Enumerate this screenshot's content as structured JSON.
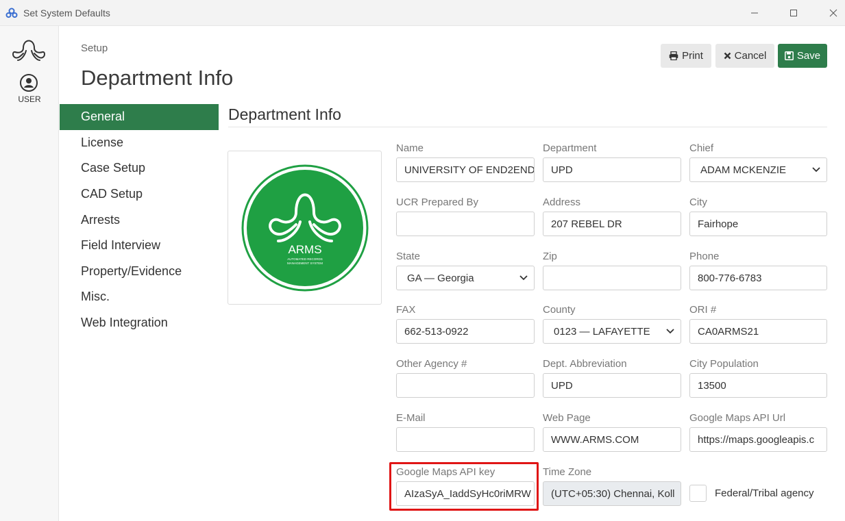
{
  "window": {
    "title": "Set System Defaults"
  },
  "leftbar": {
    "user_label": "USER"
  },
  "header": {
    "breadcrumb": "Setup",
    "title": "Department Info"
  },
  "toolbar": {
    "print_label": "Print",
    "cancel_label": "Cancel",
    "save_label": "Save"
  },
  "nav": {
    "items": [
      {
        "label": "General",
        "active": true
      },
      {
        "label": "License"
      },
      {
        "label": "Case Setup"
      },
      {
        "label": "CAD Setup"
      },
      {
        "label": "Arrests"
      },
      {
        "label": "Field Interview"
      },
      {
        "label": "Property/Evidence"
      },
      {
        "label": "Misc."
      },
      {
        "label": "Web Integration"
      }
    ]
  },
  "section": {
    "title": "Department Info"
  },
  "logo": {
    "text": "ARMS",
    "subtext1": "AUTOMATED RECORDS",
    "subtext2": "MANAGEMENT SYSTEM"
  },
  "form": {
    "name": {
      "label": "Name",
      "value": "UNIVERSITY OF END2END"
    },
    "department": {
      "label": "Department",
      "value": "UPD"
    },
    "chief": {
      "label": "Chief",
      "value": "ADAM MCKENZIE"
    },
    "ucr": {
      "label": "UCR Prepared By",
      "value": ""
    },
    "address": {
      "label": "Address",
      "value": "207 REBEL DR"
    },
    "city": {
      "label": "City",
      "value": "Fairhope"
    },
    "state": {
      "label": "State",
      "value": "GA — Georgia"
    },
    "zip": {
      "label": "Zip",
      "value": ""
    },
    "phone": {
      "label": "Phone",
      "value": "800-776-6783"
    },
    "fax": {
      "label": "FAX",
      "value": "662-513-0922"
    },
    "county": {
      "label": "County",
      "value": "0123 — LAFAYETTE"
    },
    "ori": {
      "label": "ORI #",
      "value": "CA0ARMS21"
    },
    "other_agency": {
      "label": "Other Agency #",
      "value": ""
    },
    "dept_abbrev": {
      "label": "Dept. Abbreviation",
      "value": "UPD"
    },
    "city_population": {
      "label": "City Population",
      "value": "13500"
    },
    "email": {
      "label": "E-Mail",
      "value": ""
    },
    "web_page": {
      "label": "Web Page",
      "value": "WWW.ARMS.COM"
    },
    "maps_url": {
      "label": "Google Maps API Url",
      "value": "https://maps.googleapis.c"
    },
    "maps_key": {
      "label": "Google Maps API key",
      "value": "AIzaSyA_IaddSyHc0riMRW"
    },
    "time_zone": {
      "label": "Time Zone",
      "value": "(UTC+05:30) Chennai, Koll"
    },
    "federal": {
      "label": "Federal/Tribal agency",
      "checked": false
    }
  },
  "colors": {
    "accent": "#2e7d4b",
    "highlight": "#e01515"
  }
}
